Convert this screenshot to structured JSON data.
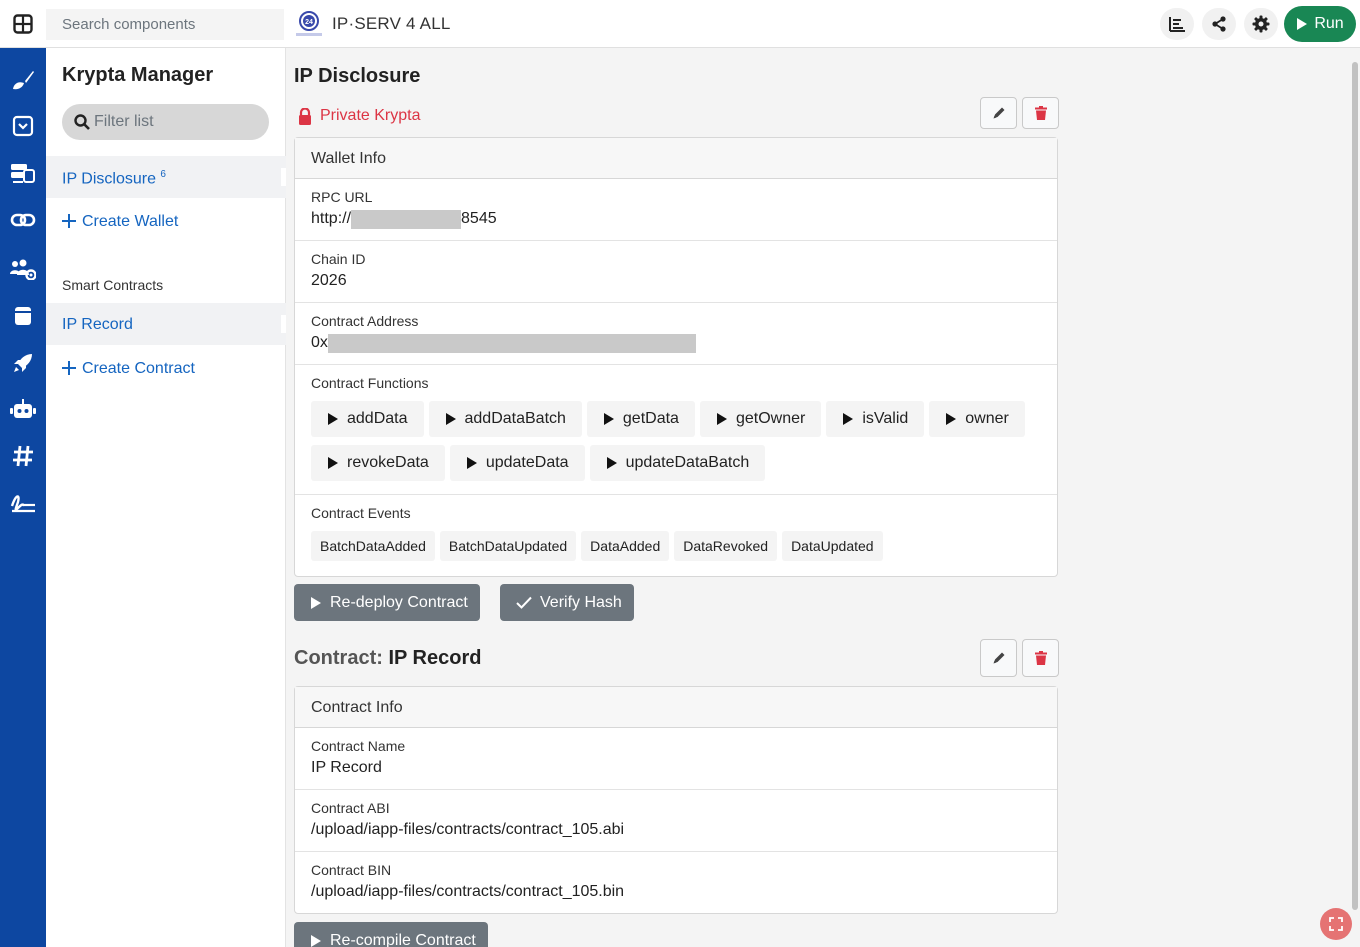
{
  "topbar": {
    "search_placeholder": "Search components",
    "app_title": "IP·SERV 4 ALL",
    "run_label": "Run"
  },
  "sidebar": {
    "title": "Krypta Manager",
    "filter_placeholder": "Filter list",
    "wallet_item": {
      "label": "IP Disclosure",
      "badge": "6"
    },
    "create_wallet": "Create Wallet",
    "section_label": "Smart Contracts",
    "contract_item": "IP Record",
    "create_contract": "Create Contract"
  },
  "wallet": {
    "title": "IP Disclosure",
    "privacy_label": "Private Krypta",
    "card_header": "Wallet Info",
    "rpc_label": "RPC URL",
    "rpc_prefix": "http://",
    "rpc_suffix": "8545",
    "chain_label": "Chain ID",
    "chain_value": "2026",
    "address_label": "Contract Address",
    "address_prefix": "0x",
    "functions_label": "Contract Functions",
    "functions": [
      "addData",
      "addDataBatch",
      "getData",
      "getOwner",
      "isValid",
      "owner",
      "revokeData",
      "updateData",
      "updateDataBatch"
    ],
    "events_label": "Contract Events",
    "events": [
      "BatchDataAdded",
      "BatchDataUpdated",
      "DataAdded",
      "DataRevoked",
      "DataUpdated"
    ],
    "redeploy_label": "Re-deploy Contract",
    "verify_label": "Verify Hash"
  },
  "contract": {
    "title_prefix": "Contract:",
    "title_name": "IP Record",
    "card_header": "Contract Info",
    "name_label": "Contract Name",
    "name_value": "IP Record",
    "abi_label": "Contract ABI",
    "abi_value": "/upload/iapp-files/contracts/contract_105.abi",
    "bin_label": "Contract BIN",
    "bin_value": "/upload/iapp-files/contracts/contract_105.bin",
    "recompile_label": "Re-compile Contract"
  },
  "colors": {
    "rail": "#0d47a1",
    "link": "#1565c0",
    "danger": "#dc3545",
    "run": "#198754",
    "secondary": "#6c757d"
  },
  "icons": [
    "grid-icon",
    "list-icon",
    "share-icon",
    "gear-icon",
    "play-icon",
    "search-icon",
    "lock-icon",
    "pencil-icon",
    "trash-icon",
    "plus-icon",
    "check-icon",
    "expand-icon"
  ]
}
